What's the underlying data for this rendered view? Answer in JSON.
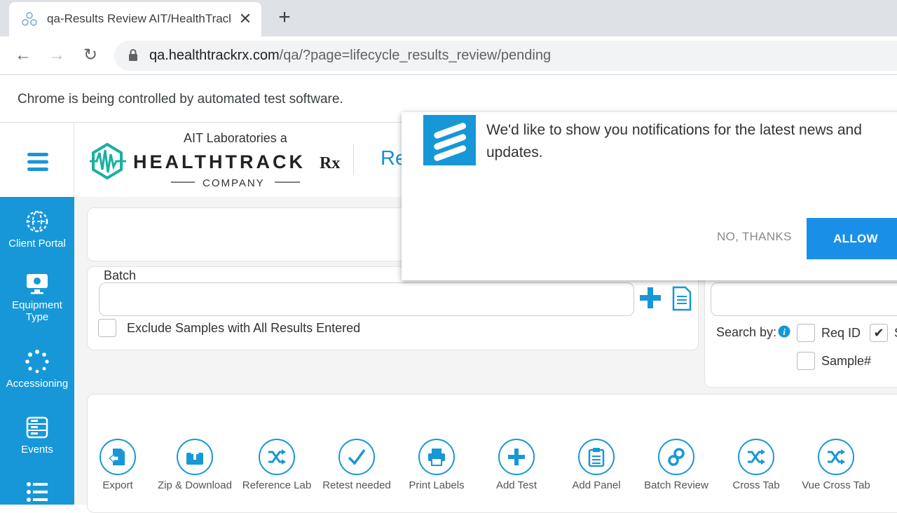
{
  "browser": {
    "tab_title": "qa-Results Review AIT/HealthTrack",
    "url_host": "qa.healthtrackrx.com",
    "url_path": "/qa/?page=lifecycle_results_review/pending",
    "infobar_text": "Chrome is being controlled by automated test software."
  },
  "header": {
    "logo_top": "AIT Laboratories a",
    "logo_brand": "HEALTHTRACK",
    "logo_rx": "Rx",
    "logo_company": "COMPANY",
    "title_partial": "Re"
  },
  "sidebar": {
    "items": [
      {
        "label": "Client Portal",
        "icon": "globe-icon"
      },
      {
        "label": "Equipment Type",
        "icon": "monitor-icon"
      },
      {
        "label": "Accessioning",
        "icon": "spinner-icon"
      },
      {
        "label": "Events",
        "icon": "server-icon"
      },
      {
        "label": "",
        "icon": "list-icon"
      }
    ]
  },
  "batch": {
    "label": "Batch",
    "input_value": "",
    "exclude_label": "Exclude Samples with All Results Entered"
  },
  "search": {
    "search_by_label": "Search by:",
    "reqid_label": "Req ID",
    "s_label": "S",
    "sample_label": "Sample#"
  },
  "actions": [
    {
      "label": "Export",
      "icon": "export-icon"
    },
    {
      "label": "Zip & Download",
      "icon": "upload-icon"
    },
    {
      "label": "Reference Lab",
      "icon": "shuffle-icon"
    },
    {
      "label": "Retest needed",
      "icon": "check-icon"
    },
    {
      "label": "Print Labels",
      "icon": "printer-icon"
    },
    {
      "label": "Add Test",
      "icon": "plus-icon"
    },
    {
      "label": "Add Panel",
      "icon": "clipboard-icon"
    },
    {
      "label": "Batch Review",
      "icon": "link-icon"
    },
    {
      "label": "Cross Tab",
      "icon": "shuffle-icon"
    },
    {
      "label": "Vue Cross Tab",
      "icon": "shuffle-icon"
    }
  ],
  "notification": {
    "text": "We'd like to show you notifications for the latest news and updates.",
    "no_label": "NO, THANKS",
    "allow_label": "ALLOW"
  },
  "colors": {
    "accent": "#1797d8",
    "allow_button": "#1a8fe8"
  }
}
